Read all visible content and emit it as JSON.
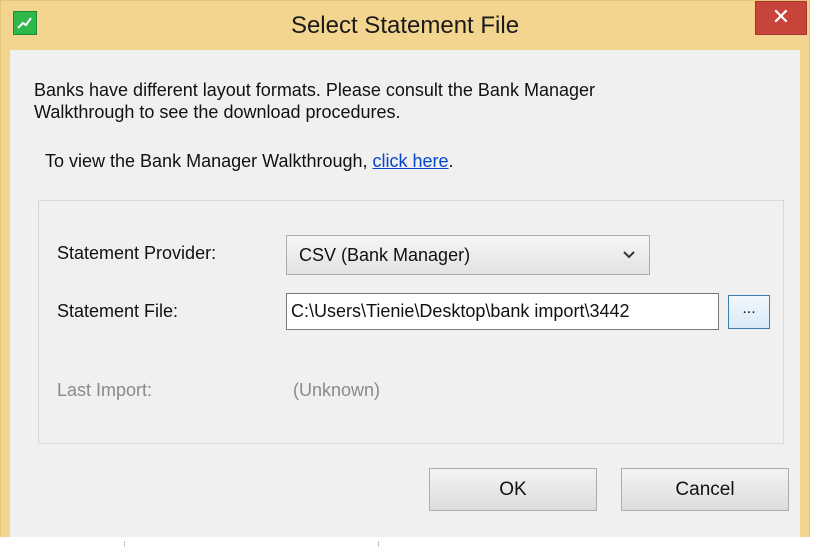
{
  "window": {
    "title": "Select Statement File",
    "close_glyph": "✕"
  },
  "intro": {
    "line1": "Banks have different layout formats.  Please consult the Bank Manager",
    "line2": "Walkthrough to see the download procedures."
  },
  "walkthrough": {
    "prefix": "To view the Bank Manager Walkthrough, ",
    "link_text": "click here",
    "suffix": "."
  },
  "form": {
    "provider_label": "Statement Provider:",
    "provider_value": "CSV (Bank Manager)",
    "file_label": "Statement File:",
    "file_value": "C:\\Users\\Tienie\\Desktop\\bank import\\3442",
    "browse_label": "...",
    "last_import_label": "Last Import:",
    "last_import_value": "(Unknown)"
  },
  "buttons": {
    "ok": "OK",
    "cancel": "Cancel"
  },
  "colors": {
    "titlebar": "#f3d58f",
    "close": "#c7443a",
    "link": "#0645cc",
    "app_icon": "#2fb84a"
  },
  "icons": {
    "app": "green-chart-icon",
    "close": "close-icon",
    "dropdown": "chevron-down-icon"
  }
}
